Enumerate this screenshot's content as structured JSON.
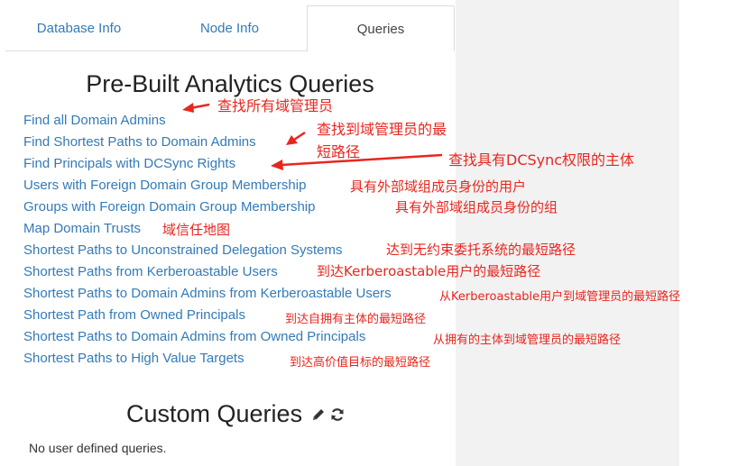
{
  "tabs": [
    {
      "label": "Database Info",
      "active": false
    },
    {
      "label": "Node Info",
      "active": false
    },
    {
      "label": "Queries",
      "active": true
    }
  ],
  "prebuilt": {
    "title": "Pre-Built Analytics Queries",
    "queries": [
      "Find all Domain Admins",
      "Find Shortest Paths to Domain Admins",
      "Find Principals with DCSync Rights",
      "Users with Foreign Domain Group Membership",
      "Groups with Foreign Domain Group Membership",
      "Map Domain Trusts",
      "Shortest Paths to Unconstrained Delegation Systems",
      "Shortest Paths from Kerberoastable Users",
      "Shortest Paths to Domain Admins from Kerberoastable Users",
      "Shortest Path from Owned Principals",
      "Shortest Paths to Domain Admins from Owned Principals",
      "Shortest Paths to High Value Targets"
    ]
  },
  "annotations": [
    "查找所有域管理员",
    "查找到域管理员的最",
    "短路径",
    "查找具有DCSync权限的主体",
    "具有外部域组成员身份的用户",
    "具有外部域组成员身份的组",
    "域信任地图",
    "达到无约束委托系统的最短路径",
    "到达Kerberoastable用户的最短路径",
    "从Kerberoastable用户到域管理员的最短路径",
    "到达自拥有主体的最短路径",
    "从拥有的主体到域管理员的最短路径",
    "到达高价值目标的最短路径"
  ],
  "custom": {
    "title": "Custom Queries",
    "edit_icon": "pencil-icon",
    "refresh_icon": "refresh-icon",
    "empty_text": "No user defined queries."
  },
  "colors": {
    "link": "#337ab7",
    "annotation": "#e8261e",
    "right_background": "#f2f2f2"
  }
}
